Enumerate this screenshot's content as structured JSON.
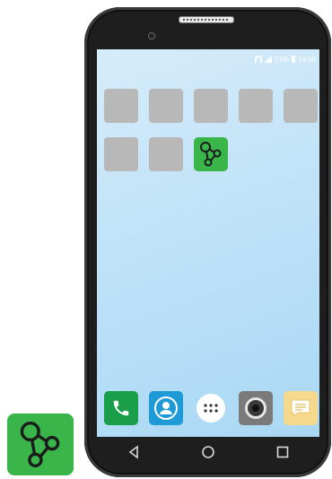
{
  "status_bar": {
    "battery_text": "71%",
    "time": "14:00"
  },
  "home": {
    "app_tiles": [
      "placeholder-app",
      "placeholder-app",
      "placeholder-app",
      "placeholder-app",
      "placeholder-app",
      "placeholder-app",
      "placeholder-app"
    ],
    "featured_app_icon": "molecule-icon"
  },
  "dock": {
    "icons": [
      "phone-icon",
      "contacts-icon",
      "app-drawer-icon",
      "camera-icon",
      "messages-icon"
    ],
    "colors": {
      "phone": "#1a9e4a",
      "contacts": "#1e9ad6",
      "app_drawer": "#ffffff",
      "camera": "#7a7a7a",
      "messages": "#f6d98c"
    }
  },
  "nav_bar": {
    "back": "back-icon",
    "home": "home-icon",
    "recents": "recents-icon"
  },
  "accent": {
    "app_green": "#39b54a",
    "phone_body": "#1e1e1e"
  }
}
